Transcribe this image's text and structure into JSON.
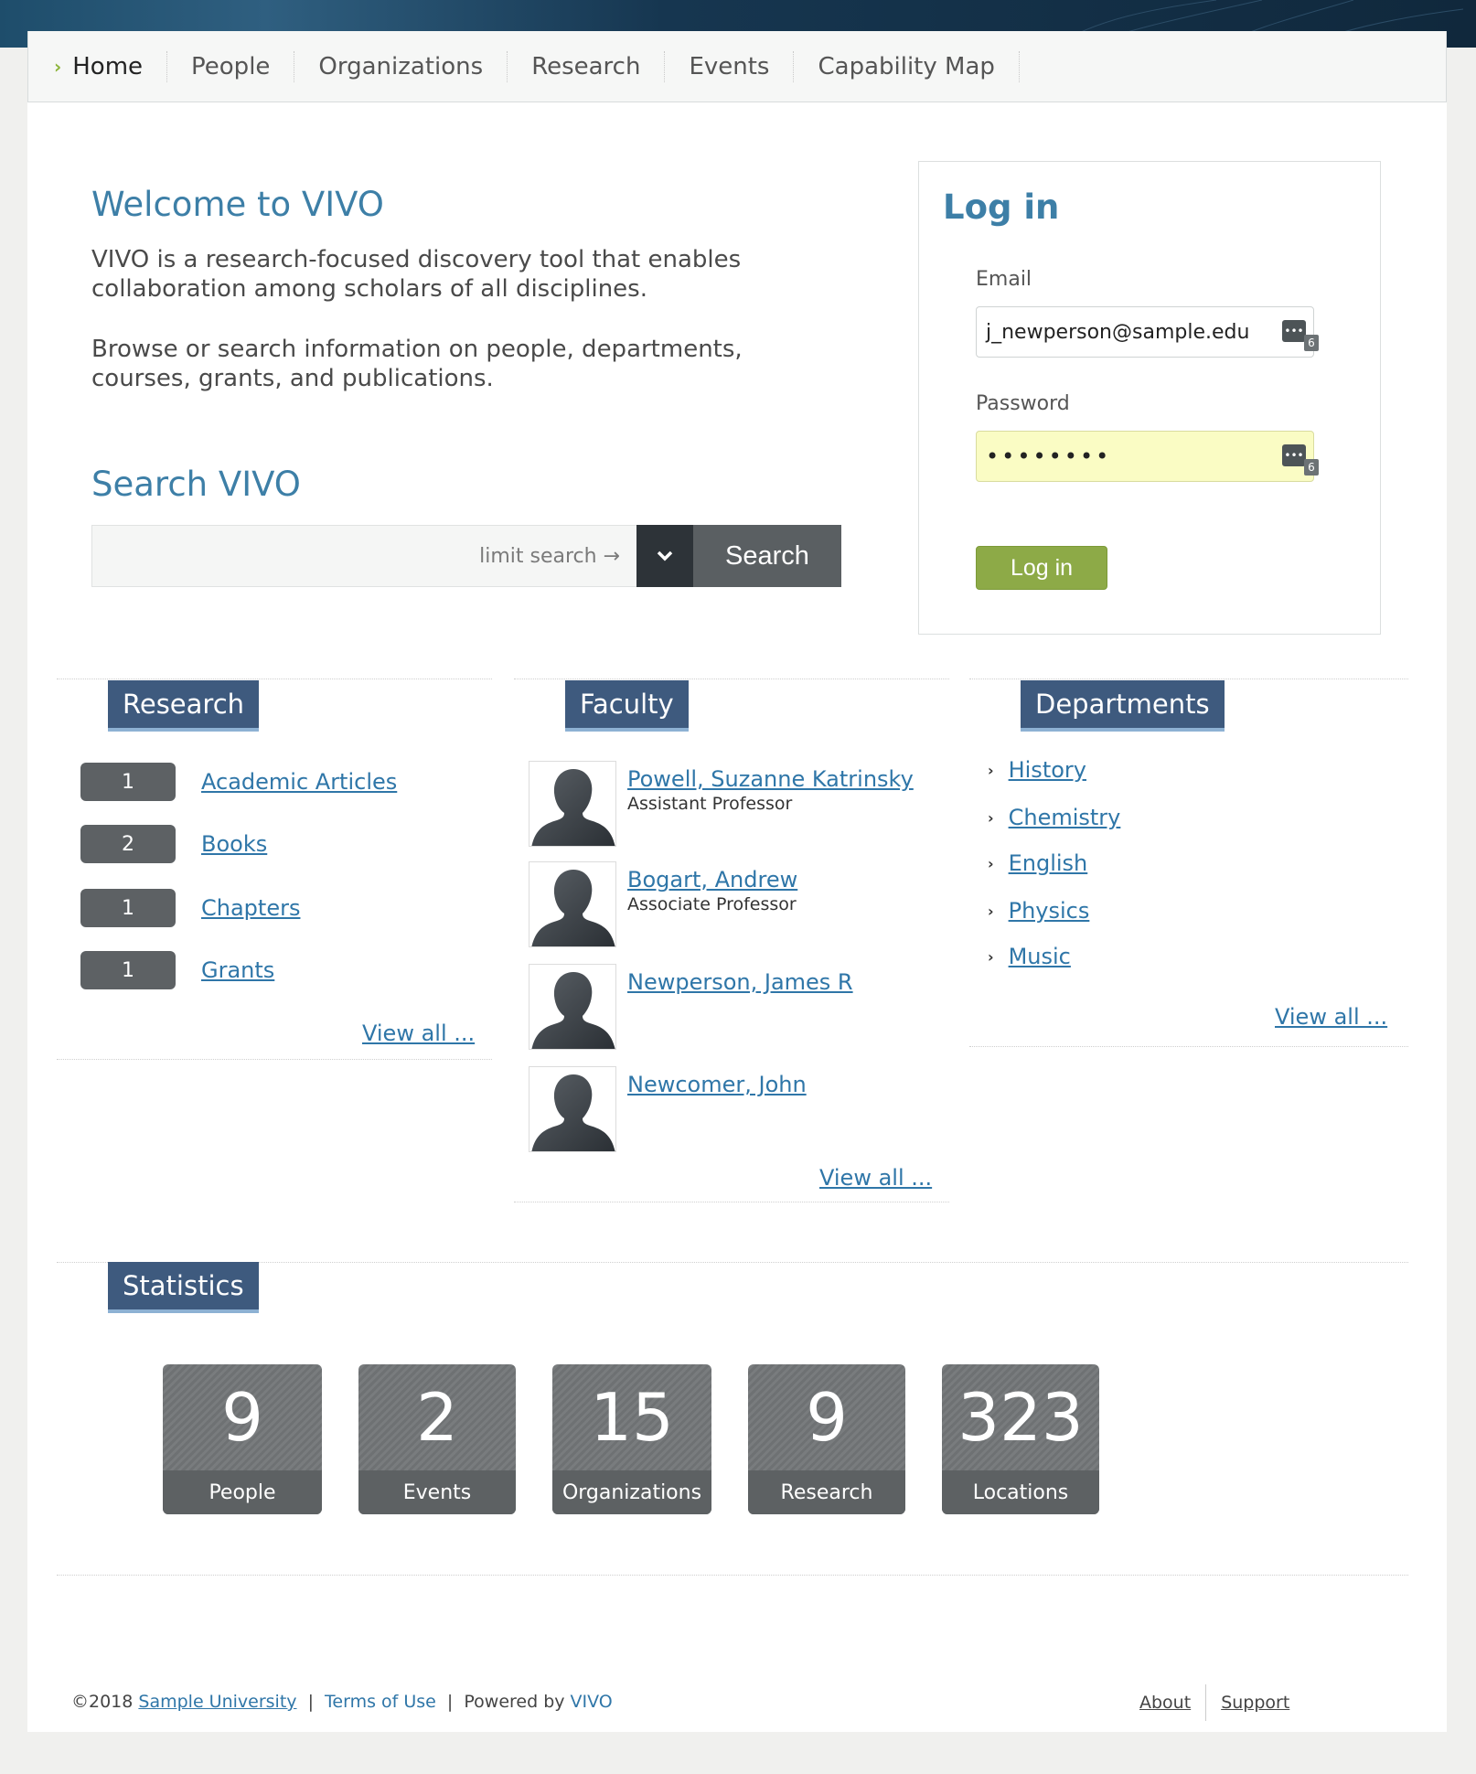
{
  "nav": {
    "items": [
      {
        "label": "Home",
        "active": true
      },
      {
        "label": "People"
      },
      {
        "label": "Organizations"
      },
      {
        "label": "Research"
      },
      {
        "label": "Events"
      },
      {
        "label": "Capability Map"
      }
    ]
  },
  "welcome": {
    "title": "Welcome to VIVO",
    "paragraph1": "VIVO is a research-focused discovery tool that enables collaboration among scholars of all disciplines.",
    "paragraph2": "Browse or search information on people, departments, courses, grants, and publications."
  },
  "search": {
    "title": "Search VIVO",
    "limit_label": "limit search →",
    "button_label": "Search"
  },
  "login": {
    "title": "Log in",
    "email_label": "Email",
    "email_value": "j_newperson@sample.edu",
    "password_label": "Password",
    "password_value": "••••••••",
    "icon_badge": "6",
    "button_label": "Log in"
  },
  "research": {
    "title": "Research",
    "items": [
      {
        "count": "1",
        "label": "Academic Articles"
      },
      {
        "count": "2",
        "label": "Books"
      },
      {
        "count": "1",
        "label": "Chapters"
      },
      {
        "count": "1",
        "label": "Grants"
      }
    ],
    "view_all": "View all ..."
  },
  "faculty": {
    "title": "Faculty",
    "items": [
      {
        "name": "Powell, Suzanne Katrinsky",
        "title": "Assistant Professor"
      },
      {
        "name": "Bogart, Andrew",
        "title": "Associate Professor"
      },
      {
        "name": "Newperson, James R",
        "title": ""
      },
      {
        "name": "Newcomer, John",
        "title": ""
      }
    ],
    "view_all": "View all ..."
  },
  "departments": {
    "title": "Departments",
    "items": [
      "History",
      "Chemistry",
      "English",
      "Physics",
      "Music"
    ],
    "view_all": "View all ..."
  },
  "statistics": {
    "title": "Statistics",
    "items": [
      {
        "value": "9",
        "label": "People"
      },
      {
        "value": "2",
        "label": "Events"
      },
      {
        "value": "15",
        "label": "Organizations"
      },
      {
        "value": "9",
        "label": "Research"
      },
      {
        "value": "323",
        "label": "Locations"
      }
    ]
  },
  "footer": {
    "copyright": "©2018",
    "university": "Sample University",
    "terms": "Terms of Use",
    "powered_by": "Powered by",
    "vivo": "VIVO",
    "about": "About",
    "support": "Support"
  },
  "colors": {
    "accent_blue": "#3d7fa7",
    "tab_navy": "#3e5a7e",
    "login_green": "#8daa47",
    "link_blue": "#2f76a8"
  }
}
